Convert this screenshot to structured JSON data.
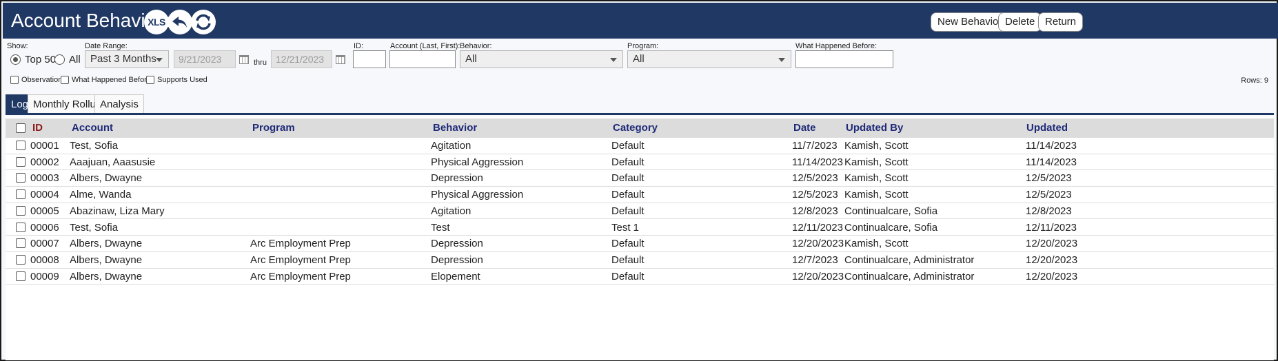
{
  "header": {
    "title": "Account Behaviors",
    "icons": {
      "xls": "XLS",
      "undo": "undo-arrow-icon",
      "refresh": "refresh-icon"
    },
    "buttons": {
      "new_behavior": "New Behavior",
      "delete": "Delete",
      "return": "Return"
    },
    "bg_color": "#1f3864"
  },
  "filters": {
    "show_label": "Show:",
    "show_options": [
      "Top 50",
      "All"
    ],
    "show_selected": "Top 50",
    "date_range_label": "Date Range:",
    "date_range_value": "Past 3 Months",
    "date_from": "9/21/2023",
    "thru_label": "thru",
    "date_to": "12/21/2023",
    "id_label": "ID:",
    "id_value": "",
    "account_label": "Account (Last, First):",
    "account_value": "",
    "behavior_label": "Behavior:",
    "behavior_value": "All",
    "program_label": "Program:",
    "program_value": "All",
    "what_happened_label": "What Happened Before:",
    "what_happened_value": "",
    "checkboxes": [
      "Observation",
      "What Happened Before",
      "Supports Used"
    ],
    "rows_label": "Rows: 9"
  },
  "tabs": [
    "Log",
    "Monthly Rollup",
    "Analysis"
  ],
  "active_tab": "Log",
  "table": {
    "columns": [
      "ID",
      "Account",
      "Program",
      "Behavior",
      "Category",
      "Date",
      "Updated By",
      "Updated"
    ],
    "rows": [
      [
        "00001",
        "Test, Sofia",
        "",
        "Agitation",
        "Default",
        "11/7/2023",
        "Kamish, Scott",
        "11/14/2023"
      ],
      [
        "00002",
        "Aaajuan, Aaasusie",
        "",
        "Physical Aggression",
        "Default",
        "11/14/2023",
        "Kamish, Scott",
        "11/14/2023"
      ],
      [
        "00003",
        "Albers, Dwayne",
        "",
        "Depression",
        "Default",
        "12/5/2023",
        "Kamish, Scott",
        "12/5/2023"
      ],
      [
        "00004",
        "Alme, Wanda",
        "",
        "Physical Aggression",
        "Default",
        "12/5/2023",
        "Kamish, Scott",
        "12/5/2023"
      ],
      [
        "00005",
        "Abazinaw, Liza Mary",
        "",
        "Agitation",
        "Default",
        "12/8/2023",
        "Continualcare, Sofia",
        "12/8/2023"
      ],
      [
        "00006",
        "Test, Sofia",
        "",
        "Test",
        "Test 1",
        "12/11/2023",
        "Continualcare, Sofia",
        "12/11/2023"
      ],
      [
        "00007",
        "Albers, Dwayne",
        "Arc Employment Prep",
        "Depression",
        "Default",
        "12/20/2023",
        "Kamish, Scott",
        "12/20/2023"
      ],
      [
        "00008",
        "Albers, Dwayne",
        "Arc Employment Prep",
        "Depression",
        "Default",
        "12/7/2023",
        "Continualcare, Administrator",
        "12/20/2023"
      ],
      [
        "00009",
        "Albers, Dwayne",
        "Arc Employment Prep",
        "Elopement",
        "Default",
        "12/20/2023",
        "Continualcare, Administrator",
        "12/20/2023"
      ]
    ]
  }
}
